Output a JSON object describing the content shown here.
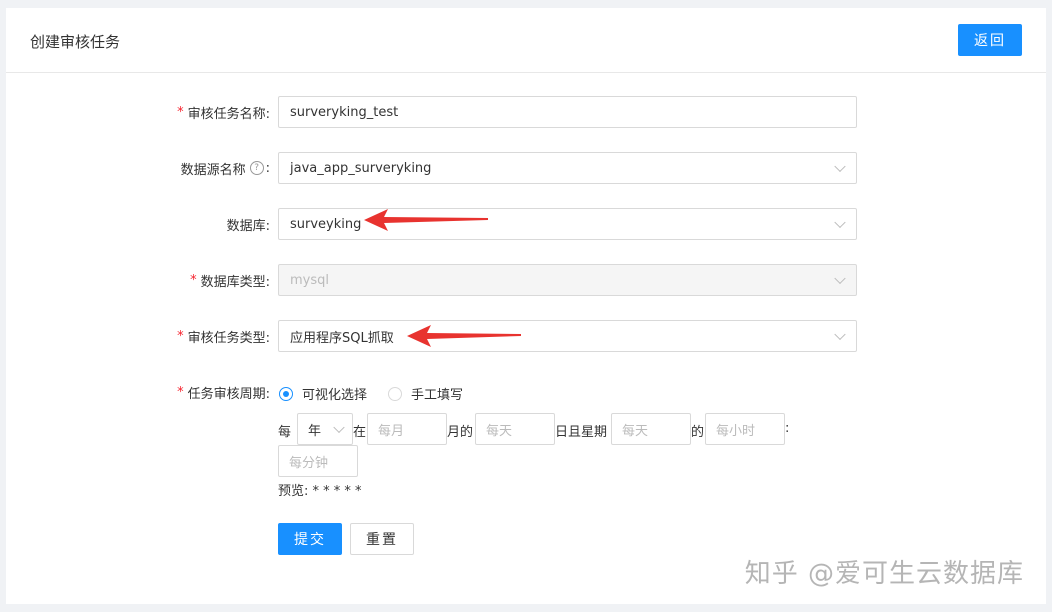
{
  "header": {
    "title": "创建审核任务",
    "back_label": "返回"
  },
  "form": {
    "task_name": {
      "label": "审核任务名称:",
      "required": true,
      "value": "surveryking_test"
    },
    "datasource": {
      "label": "数据源名称",
      "colon": ":",
      "help": "?",
      "value": "java_app_surveryking"
    },
    "database": {
      "label": "数据库:",
      "value": "surveyking"
    },
    "db_type": {
      "label": "数据库类型:",
      "required": true,
      "value": "mysql"
    },
    "task_type": {
      "label": "审核任务类型:",
      "required": true,
      "value": "应用程序SQL抓取"
    },
    "cycle": {
      "label": "任务审核周期:",
      "required": true,
      "option_visual": "可视化选择",
      "option_manual": "手工填写",
      "selected": "可视化选择"
    },
    "schedule": {
      "every": "每",
      "unit": "年",
      "at": "在",
      "month_placeholder": "每月",
      "month_suffix": "月的",
      "day_placeholder": "每天",
      "day_weekday_text": "日且星期",
      "weekday_placeholder": "每天",
      "of": "的",
      "hour_placeholder": "每小时",
      "colon": ":",
      "minute_placeholder": "每分钟",
      "preview": "预览: * * * * *"
    },
    "submit_label": "提交",
    "reset_label": "重置"
  },
  "watermark": "知乎 @爱可生云数据库",
  "colors": {
    "primary": "#1890ff",
    "required": "#f5222d",
    "arrow": "#e8332f"
  }
}
